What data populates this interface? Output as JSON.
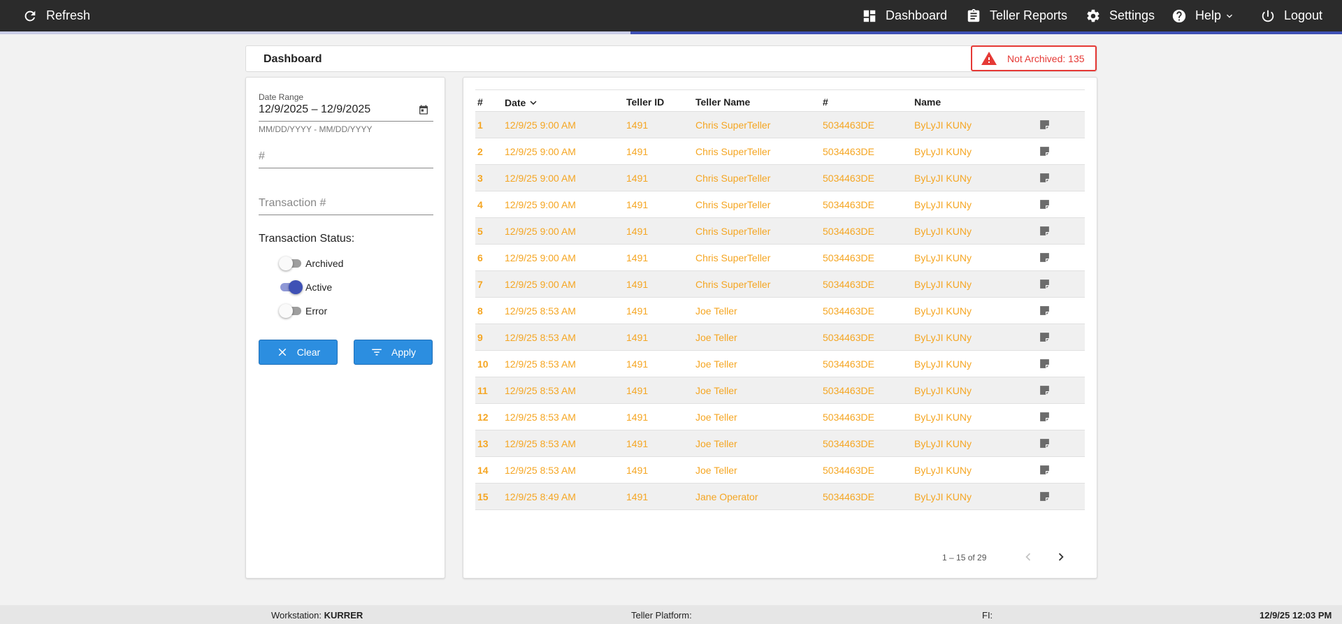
{
  "topbar": {
    "refresh_label": "Refresh",
    "dashboard_label": "Dashboard",
    "teller_reports_label": "Teller Reports",
    "settings_label": "Settings",
    "help_label": "Help",
    "logout_label": "Logout",
    "progress_fraction": 0.53,
    "accent_color": "#3f51b5"
  },
  "header": {
    "title": "Dashboard",
    "alert_label": "Not Archived: 135",
    "alert_color": "#e53935"
  },
  "filters": {
    "date_range_label": "Date Range",
    "date_range_value": "12/9/2025 – 12/9/2025",
    "date_range_hint": "MM/DD/YYYY - MM/DD/YYYY",
    "number_placeholder": "#",
    "transaction_placeholder": "Transaction #",
    "status_title": "Transaction Status:",
    "statuses": [
      {
        "label": "Archived",
        "on": false
      },
      {
        "label": "Active",
        "on": true
      },
      {
        "label": "Error",
        "on": false
      }
    ],
    "clear_label": "Clear",
    "apply_label": "Apply",
    "button_color": "#2c8ee0"
  },
  "table": {
    "columns": [
      "#",
      "Date",
      "Teller ID",
      "Teller Name",
      "#",
      "Name"
    ],
    "row_color": "#f5a623",
    "rows": [
      {
        "n": "1",
        "date": "12/9/25 9:00 AM",
        "teller_id": "1491",
        "teller_name": "Chris SuperTeller",
        "num": "5034463DE",
        "name": "ByLyJI KUNy"
      },
      {
        "n": "2",
        "date": "12/9/25 9:00 AM",
        "teller_id": "1491",
        "teller_name": "Chris SuperTeller",
        "num": "5034463DE",
        "name": "ByLyJI KUNy"
      },
      {
        "n": "3",
        "date": "12/9/25 9:00 AM",
        "teller_id": "1491",
        "teller_name": "Chris SuperTeller",
        "num": "5034463DE",
        "name": "ByLyJI KUNy"
      },
      {
        "n": "4",
        "date": "12/9/25 9:00 AM",
        "teller_id": "1491",
        "teller_name": "Chris SuperTeller",
        "num": "5034463DE",
        "name": "ByLyJI KUNy"
      },
      {
        "n": "5",
        "date": "12/9/25 9:00 AM",
        "teller_id": "1491",
        "teller_name": "Chris SuperTeller",
        "num": "5034463DE",
        "name": "ByLyJI KUNy"
      },
      {
        "n": "6",
        "date": "12/9/25 9:00 AM",
        "teller_id": "1491",
        "teller_name": "Chris SuperTeller",
        "num": "5034463DE",
        "name": "ByLyJI KUNy"
      },
      {
        "n": "7",
        "date": "12/9/25 9:00 AM",
        "teller_id": "1491",
        "teller_name": "Chris SuperTeller",
        "num": "5034463DE",
        "name": "ByLyJI KUNy"
      },
      {
        "n": "8",
        "date": "12/9/25 8:53 AM",
        "teller_id": "1491",
        "teller_name": "Joe Teller",
        "num": "5034463DE",
        "name": "ByLyJI KUNy"
      },
      {
        "n": "9",
        "date": "12/9/25 8:53 AM",
        "teller_id": "1491",
        "teller_name": "Joe Teller",
        "num": "5034463DE",
        "name": "ByLyJI KUNy"
      },
      {
        "n": "10",
        "date": "12/9/25 8:53 AM",
        "teller_id": "1491",
        "teller_name": "Joe Teller",
        "num": "5034463DE",
        "name": "ByLyJI KUNy"
      },
      {
        "n": "11",
        "date": "12/9/25 8:53 AM",
        "teller_id": "1491",
        "teller_name": "Joe Teller",
        "num": "5034463DE",
        "name": "ByLyJI KUNy"
      },
      {
        "n": "12",
        "date": "12/9/25 8:53 AM",
        "teller_id": "1491",
        "teller_name": "Joe Teller",
        "num": "5034463DE",
        "name": "ByLyJI KUNy"
      },
      {
        "n": "13",
        "date": "12/9/25 8:53 AM",
        "teller_id": "1491",
        "teller_name": "Joe Teller",
        "num": "5034463DE",
        "name": "ByLyJI KUNy"
      },
      {
        "n": "14",
        "date": "12/9/25 8:53 AM",
        "teller_id": "1491",
        "teller_name": "Joe Teller",
        "num": "5034463DE",
        "name": "ByLyJI KUNy"
      },
      {
        "n": "15",
        "date": "12/9/25 8:49 AM",
        "teller_id": "1491",
        "teller_name": "Jane Operator",
        "num": "5034463DE",
        "name": "ByLyJI KUNy"
      }
    ],
    "row_icon": "note-icon",
    "pager_text": "1 – 15 of 29"
  },
  "footer": {
    "workstation_label": "Workstation:",
    "workstation_value": "KURRER",
    "platform_label": "Teller Platform:",
    "fi_label": "FI:",
    "datetime": "12/9/25 12:03 PM"
  }
}
